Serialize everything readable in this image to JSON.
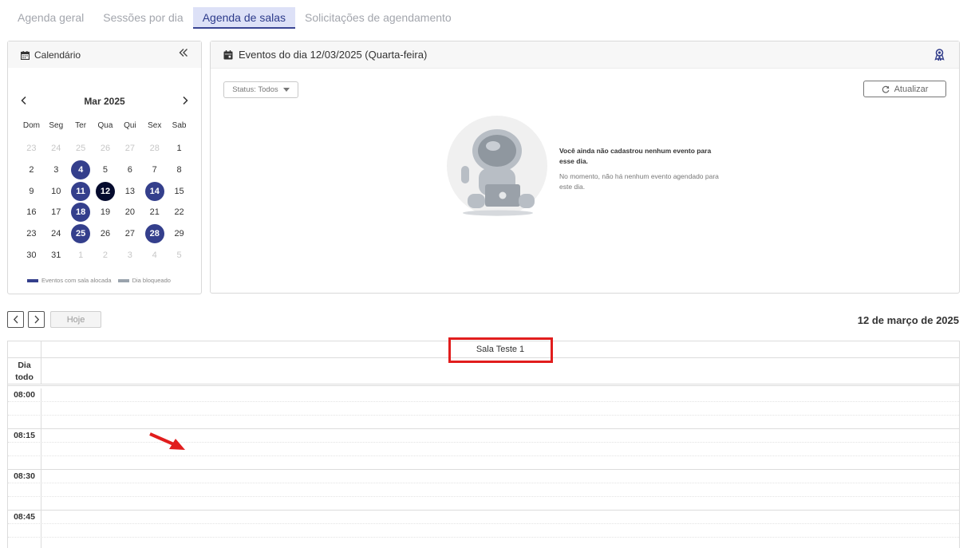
{
  "tabs": [
    {
      "label": "Agenda geral"
    },
    {
      "label": "Sessões por dia"
    },
    {
      "label": "Agenda de salas"
    },
    {
      "label": "Solicitações de agendamento"
    }
  ],
  "calendar_panel": {
    "title": "Calendário",
    "collapse_icon": "double-chevron-left-icon",
    "month_label": "Mar 2025",
    "weekdays": [
      "Dom",
      "Seg",
      "Ter",
      "Qua",
      "Qui",
      "Sex",
      "Sab"
    ],
    "days": [
      {
        "n": "23",
        "state": "muted"
      },
      {
        "n": "24",
        "state": "muted"
      },
      {
        "n": "25",
        "state": "muted"
      },
      {
        "n": "26",
        "state": "muted"
      },
      {
        "n": "27",
        "state": "muted"
      },
      {
        "n": "28",
        "state": "muted"
      },
      {
        "n": "1",
        "state": "normal"
      },
      {
        "n": "2",
        "state": "normal"
      },
      {
        "n": "3",
        "state": "normal"
      },
      {
        "n": "4",
        "state": "event"
      },
      {
        "n": "5",
        "state": "normal"
      },
      {
        "n": "6",
        "state": "normal"
      },
      {
        "n": "7",
        "state": "normal"
      },
      {
        "n": "8",
        "state": "normal"
      },
      {
        "n": "9",
        "state": "normal"
      },
      {
        "n": "10",
        "state": "normal"
      },
      {
        "n": "11",
        "state": "event"
      },
      {
        "n": "12",
        "state": "selected"
      },
      {
        "n": "13",
        "state": "normal"
      },
      {
        "n": "14",
        "state": "event"
      },
      {
        "n": "15",
        "state": "normal"
      },
      {
        "n": "16",
        "state": "normal"
      },
      {
        "n": "17",
        "state": "normal"
      },
      {
        "n": "18",
        "state": "event"
      },
      {
        "n": "19",
        "state": "normal"
      },
      {
        "n": "20",
        "state": "normal"
      },
      {
        "n": "21",
        "state": "normal"
      },
      {
        "n": "22",
        "state": "normal"
      },
      {
        "n": "23",
        "state": "normal"
      },
      {
        "n": "24",
        "state": "normal"
      },
      {
        "n": "25",
        "state": "event"
      },
      {
        "n": "26",
        "state": "normal"
      },
      {
        "n": "27",
        "state": "normal"
      },
      {
        "n": "28",
        "state": "event"
      },
      {
        "n": "29",
        "state": "normal"
      },
      {
        "n": "30",
        "state": "normal"
      },
      {
        "n": "31",
        "state": "normal"
      },
      {
        "n": "1",
        "state": "muted"
      },
      {
        "n": "2",
        "state": "muted"
      },
      {
        "n": "3",
        "state": "muted"
      },
      {
        "n": "4",
        "state": "muted"
      },
      {
        "n": "5",
        "state": "muted"
      }
    ],
    "legend": [
      {
        "label": "Eventos com sala alocada",
        "color": "#343f8c"
      },
      {
        "label": "Dia bloqueado",
        "color": "#9aa3ad"
      }
    ]
  },
  "events_panel": {
    "title": "Eventos do dia 12/03/2025 (Quarta-feira)",
    "status_filter": "Status: Todos",
    "refresh_label": "Atualizar",
    "empty_title": "Você ainda não cadastrou nenhum evento para esse dia.",
    "empty_subtitle": "No momento, não há nenhum evento agendado para este dia."
  },
  "toolbar": {
    "prev_icon": "chevron-left-icon",
    "next_icon": "chevron-right-icon",
    "today_label": "Hoje",
    "date_heading": "12 de março de 2025"
  },
  "schedule": {
    "resource": "Sala Teste 1",
    "allday_label": "Dia todo",
    "times": [
      "08:00",
      "08:15",
      "08:30",
      "08:45"
    ]
  },
  "colors": {
    "accent": "#343f8c",
    "selected": "#050b2e",
    "annotation": "#e11d1d"
  }
}
